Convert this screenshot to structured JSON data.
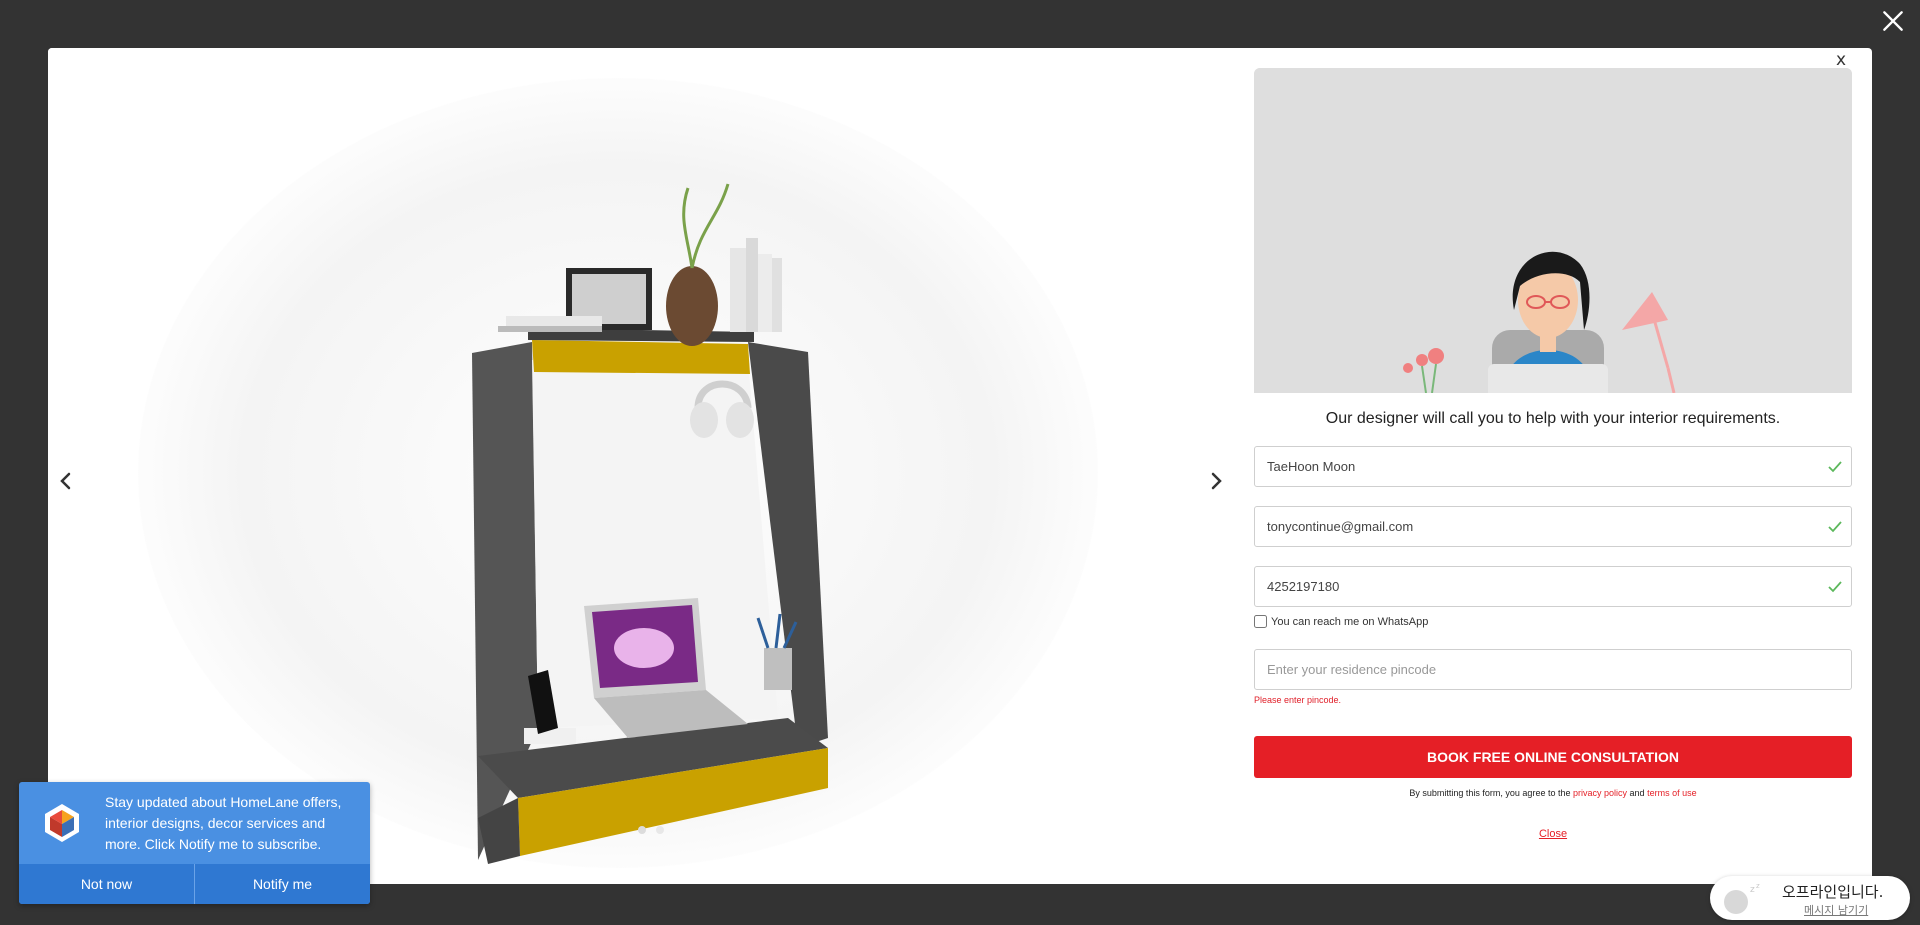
{
  "overlay": {
    "close_icon": "close-x-icon"
  },
  "gallery": {
    "prev_icon": "chevron-left-icon",
    "next_icon": "chevron-right-icon",
    "slide_count": 2,
    "active_slide": 1
  },
  "form": {
    "close_label": "x",
    "tagline": "Our designer will call you to help with your interior requirements.",
    "name_value": "TaeHoon Moon",
    "email_value": "tonycontinue@gmail.com",
    "phone_value": "4252197180",
    "whatsapp_label": "You can reach me on WhatsApp",
    "whatsapp_checked": false,
    "pincode_placeholder": "Enter your residence pincode",
    "pincode_error": "Please enter pincode.",
    "submit_label": "BOOK FREE ONLINE CONSULTATION",
    "terms_prefix": "By submitting this form, you agree to the",
    "privacy_link": "privacy policy",
    "terms_and": "and",
    "terms_link": "terms of use",
    "close_link": "Close",
    "valid_color": "#5cb85c",
    "accent_color": "#e51f26"
  },
  "notification": {
    "message": "Stay updated about HomeLane offers, interior designs, decor services and more. Click Notify me to subscribe.",
    "not_now_label": "Not now",
    "notify_label": "Notify me"
  },
  "chat": {
    "status": "오프라인입니다.",
    "leave_message": "메시지 남기기"
  }
}
